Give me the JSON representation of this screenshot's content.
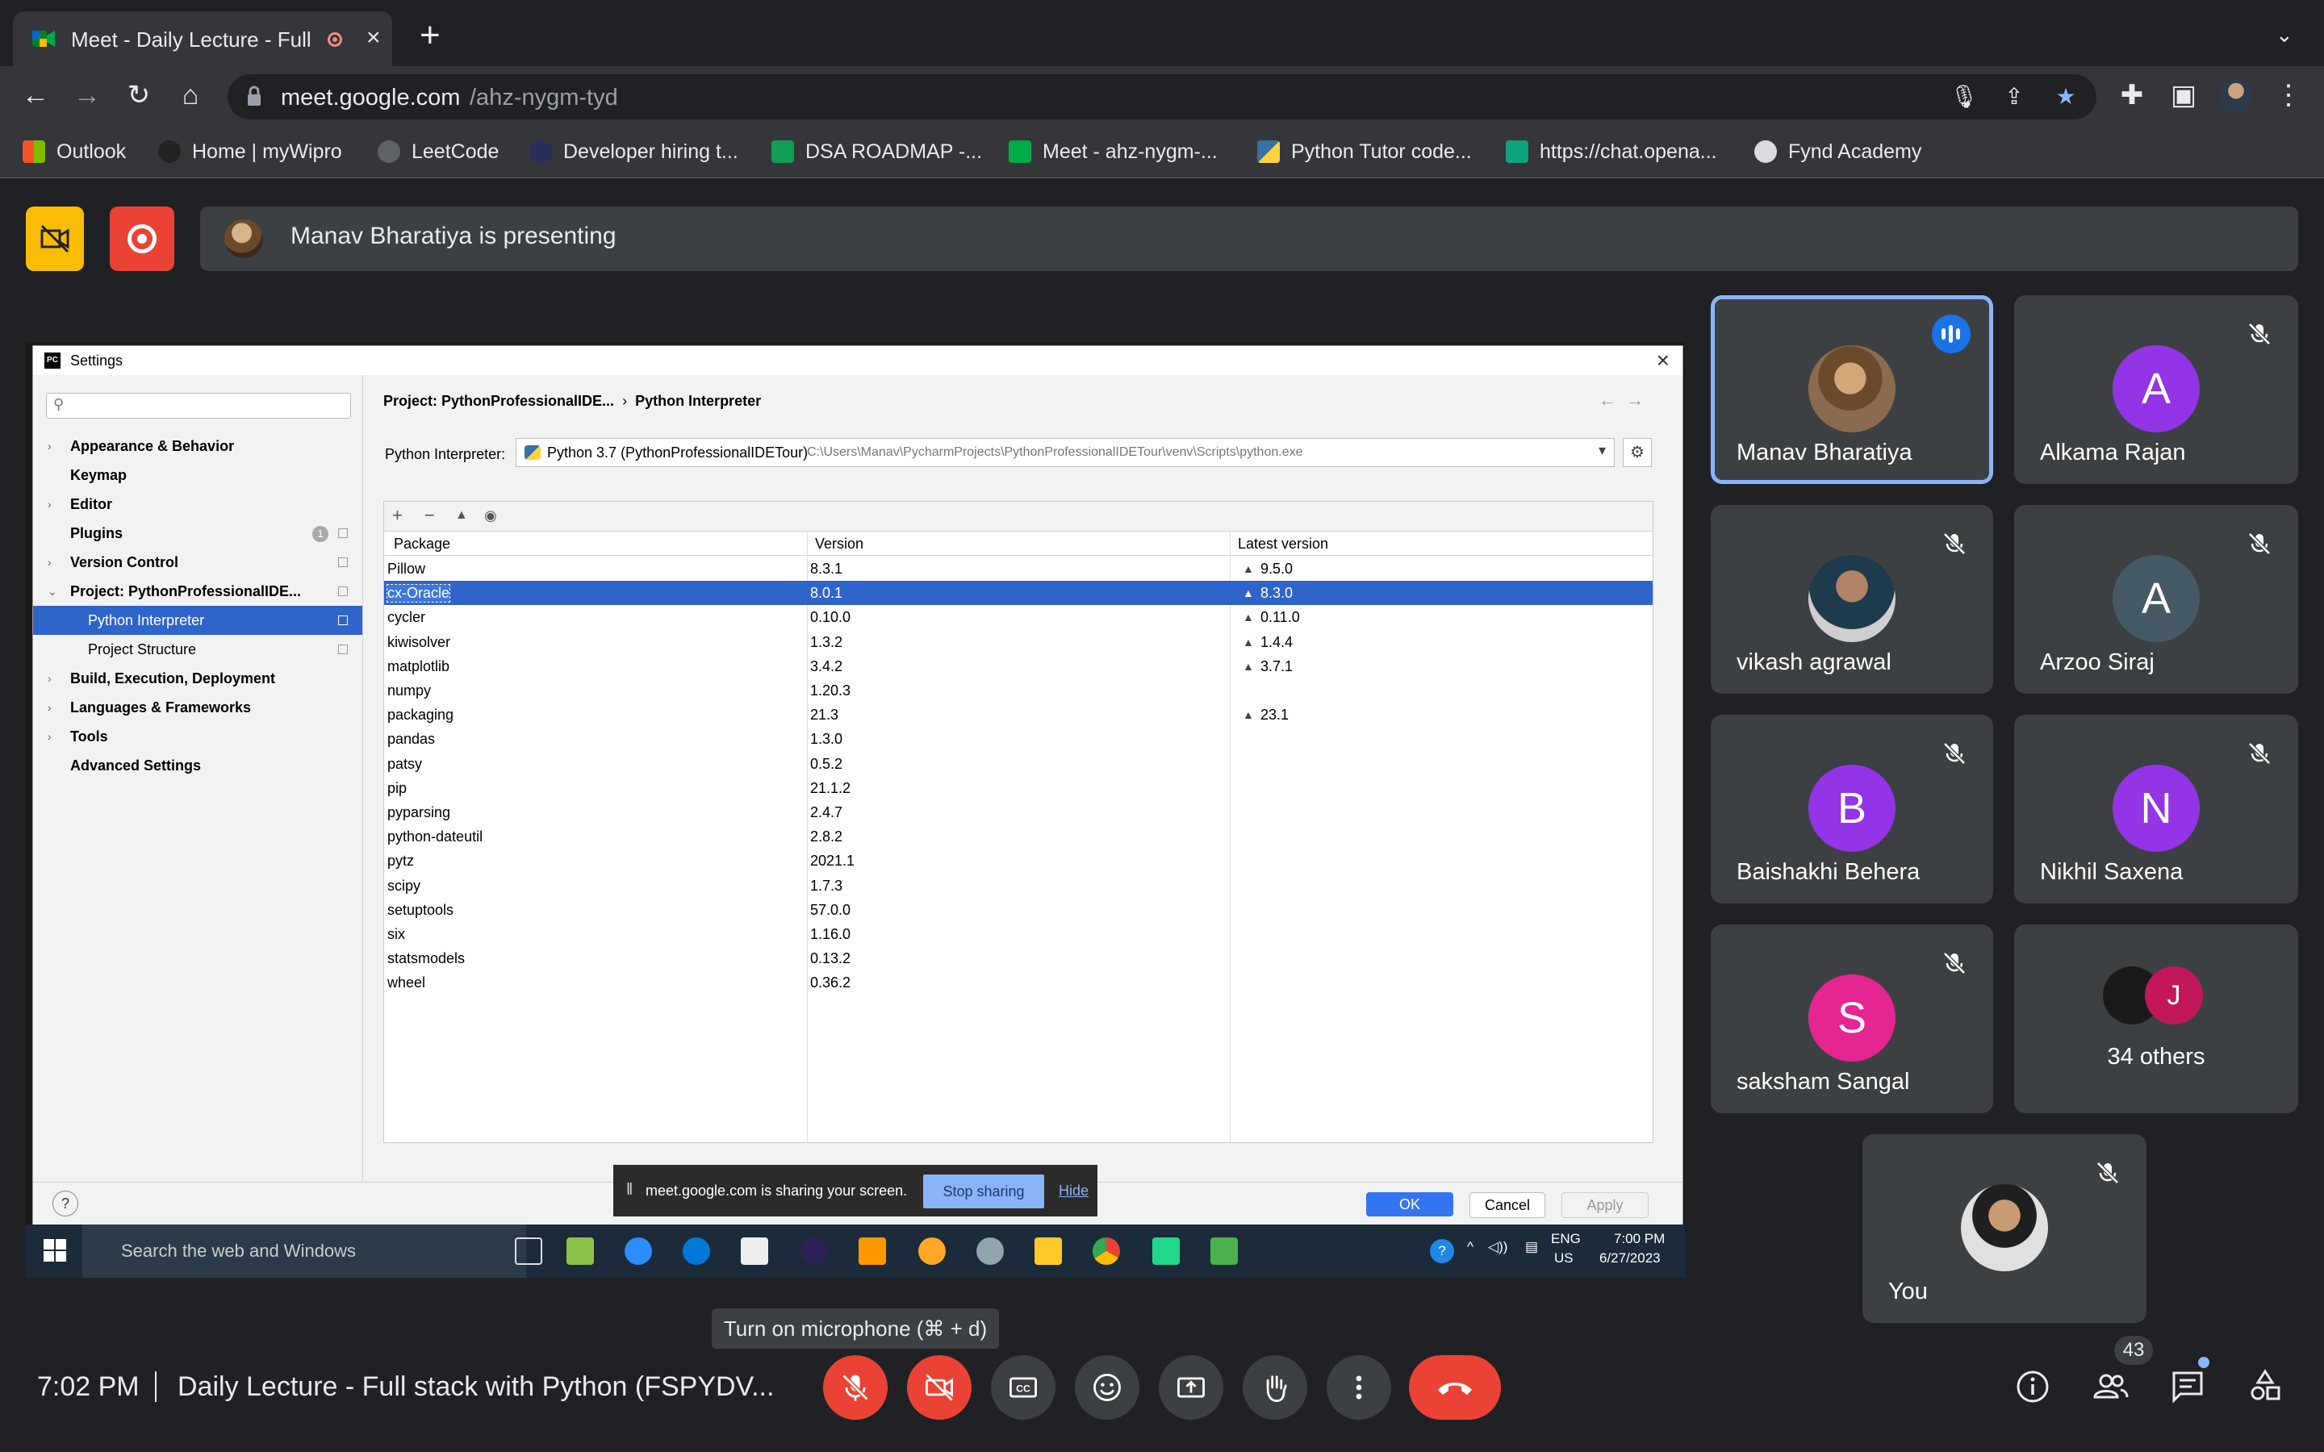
{
  "browser": {
    "tab_title": "Meet - Daily Lecture - Full",
    "url_host": "meet.google.com",
    "url_path": "/ahz-nygm-tyd",
    "bookmarks": [
      "Outlook",
      "Home | myWipro",
      "LeetCode",
      "Developer hiring t...",
      "DSA ROADMAP -...",
      "Meet - ahz-nygm-...",
      "Python Tutor code...",
      "https://chat.opena...",
      "Fynd Academy"
    ]
  },
  "meet": {
    "presenting_text": "Manav Bharatiya is presenting",
    "clock": "7:02 PM",
    "meeting_title": "Daily Lecture - Full stack with Python (FSPYDV...",
    "tooltip": "Turn on microphone (⌘ + d)",
    "people_count": "43",
    "participants": [
      "Manav Bharatiya",
      "Alkama Rajan",
      "vikash agrawal",
      "Arzoo Siraj",
      "Baishakhi Behera",
      "Nikhil Saxena",
      "saksham Sangal",
      "34 others",
      "You"
    ],
    "avatar_letters": {
      "alkama": "A",
      "arzoo": "A",
      "baishakhi": "B",
      "nikhil": "N",
      "saksham": "S",
      "others": "J"
    },
    "colors": {
      "mute_red": "#ea4335",
      "tile_bg": "#3c4043",
      "active_border": "#8ab4f8",
      "alkama": "#9334e6",
      "arzoo": "#455a64",
      "baishakhi": "#9334e6",
      "nikhil": "#9334e6",
      "saksham": "#e52592"
    }
  },
  "settings": {
    "window_title": "Settings",
    "breadcrumb_project": "Project: PythonProfessionalIDE...",
    "breadcrumb_page": "Python Interpreter",
    "tree": [
      "Appearance & Behavior",
      "Keymap",
      "Editor",
      "Plugins",
      "Version Control",
      "Project: PythonProfessionalIDE...",
      "Python Interpreter",
      "Project Structure",
      "Build, Execution, Deployment",
      "Languages & Frameworks",
      "Tools",
      "Advanced Settings"
    ],
    "plugins_badge": "1",
    "interpreter_label": "Python Interpreter:",
    "interpreter_value": "Python 3.7 (PythonProfessionalIDETour)",
    "interpreter_path": "C:\\Users\\Manav\\PycharmProjects\\PythonProfessionalIDETour\\venv\\Scripts\\python.exe",
    "columns": [
      "Package",
      "Version",
      "Latest version"
    ],
    "packages": [
      {
        "name": "Pillow",
        "version": "8.3.1",
        "latest": "9.5.0"
      },
      {
        "name": "cx-Oracle",
        "version": "8.0.1",
        "latest": "8.3.0"
      },
      {
        "name": "cycler",
        "version": "0.10.0",
        "latest": "0.11.0"
      },
      {
        "name": "kiwisolver",
        "version": "1.3.2",
        "latest": "1.4.4"
      },
      {
        "name": "matplotlib",
        "version": "3.4.2",
        "latest": "3.7.1"
      },
      {
        "name": "numpy",
        "version": "1.20.3",
        "latest": ""
      },
      {
        "name": "packaging",
        "version": "21.3",
        "latest": "23.1"
      },
      {
        "name": "pandas",
        "version": "1.3.0",
        "latest": ""
      },
      {
        "name": "patsy",
        "version": "0.5.2",
        "latest": ""
      },
      {
        "name": "pip",
        "version": "21.1.2",
        "latest": ""
      },
      {
        "name": "pyparsing",
        "version": "2.4.7",
        "latest": ""
      },
      {
        "name": "python-dateutil",
        "version": "2.8.2",
        "latest": ""
      },
      {
        "name": "pytz",
        "version": "2021.1",
        "latest": ""
      },
      {
        "name": "scipy",
        "version": "1.7.3",
        "latest": ""
      },
      {
        "name": "setuptools",
        "version": "57.0.0",
        "latest": ""
      },
      {
        "name": "six",
        "version": "1.16.0",
        "latest": ""
      },
      {
        "name": "statsmodels",
        "version": "0.13.2",
        "latest": ""
      },
      {
        "name": "wheel",
        "version": "0.36.2",
        "latest": ""
      }
    ],
    "buttons": {
      "ok": "OK",
      "cancel": "Cancel",
      "apply": "Apply",
      "help": "?"
    },
    "share_notice": "meet.google.com is sharing your screen.",
    "stop_sharing": "Stop sharing",
    "hide": "Hide"
  },
  "taskbar": {
    "search": "Search the web and Windows",
    "lang": "ENG",
    "region": "US",
    "time": "7:00 PM",
    "date": "6/27/2023"
  }
}
